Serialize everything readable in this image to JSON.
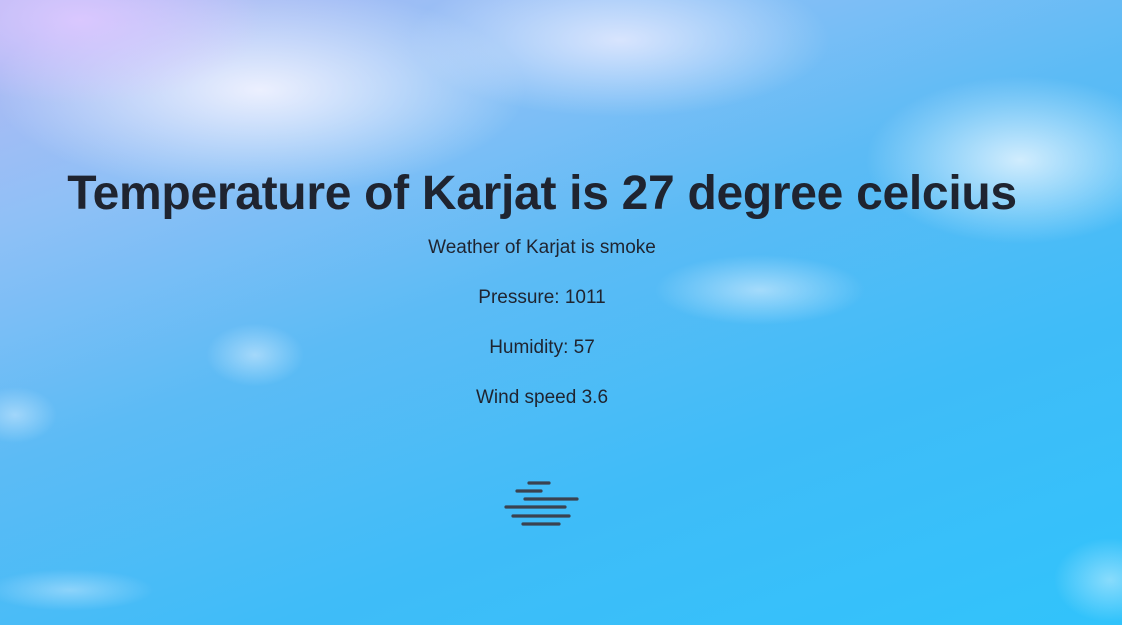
{
  "city": "Karjat",
  "title": "Temperature of Karjat is 27 degree celcius",
  "weather": "Weather of Karjat is smoke",
  "pressure": "Pressure: 1011",
  "humidity": "Humidity: 57",
  "wind": "Wind speed 3.6",
  "icon": "smoke-fog-icon",
  "colors": {
    "text": "#1f2430",
    "sky_top": "#b7b8f3",
    "sky_bottom": "#31c3fb",
    "icon": "#3a4250"
  }
}
